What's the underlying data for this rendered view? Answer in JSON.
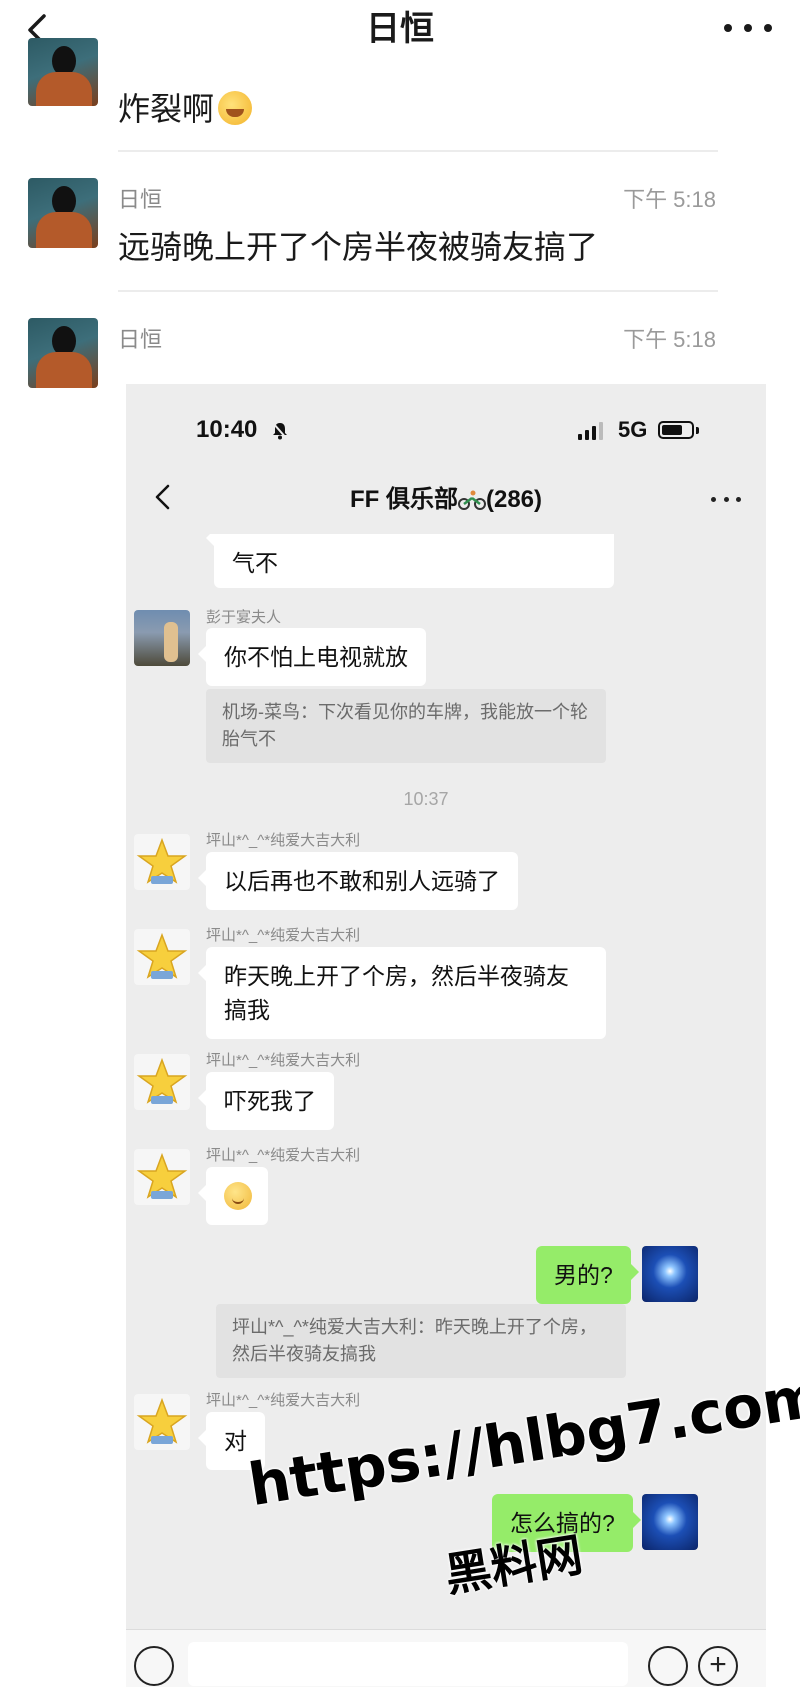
{
  "outer": {
    "title": "日恒",
    "messages": [
      {
        "text": "炸裂啊",
        "emoji": "laughing-tears-emoji"
      },
      {
        "sender": "日恒",
        "time": "下午 5:18",
        "text": "远骑晚上开了个房半夜被骑友搞了"
      },
      {
        "sender": "日恒",
        "time": "下午 5:18"
      }
    ]
  },
  "screenshot": {
    "status": {
      "time": "10:40",
      "network": "5G"
    },
    "nav": {
      "title": "FF 俱乐部",
      "count": "(286)"
    },
    "top_partial": "气不",
    "msg_peng": {
      "sender": "彭于宴夫人",
      "text": "你不怕上电视就放"
    },
    "quote1": "机场-菜鸟：下次看见你的车牌，我能放一个轮胎气不",
    "timestamp": "10:37",
    "star_sender": "坪山*^_^*纯爱大吉大利",
    "star_msgs": [
      "以后再也不敢和别人远骑了",
      "昨天晚上开了个房，然后半夜骑友搞我",
      "吓死我了"
    ],
    "star_emoji": "smile-emoji",
    "my_msg1": "男的?",
    "quote2": "坪山*^_^*纯爱大吉大利：昨天晚上开了个房，然后半夜骑友搞我",
    "reply_dui": "对",
    "my_msg2": "怎么搞的?"
  },
  "watermark": {
    "line1": "https://hlbg7.com",
    "line2": "黑料网"
  },
  "colors": {
    "bubble_green": "#95ec69",
    "chat_bg": "#ededed"
  }
}
